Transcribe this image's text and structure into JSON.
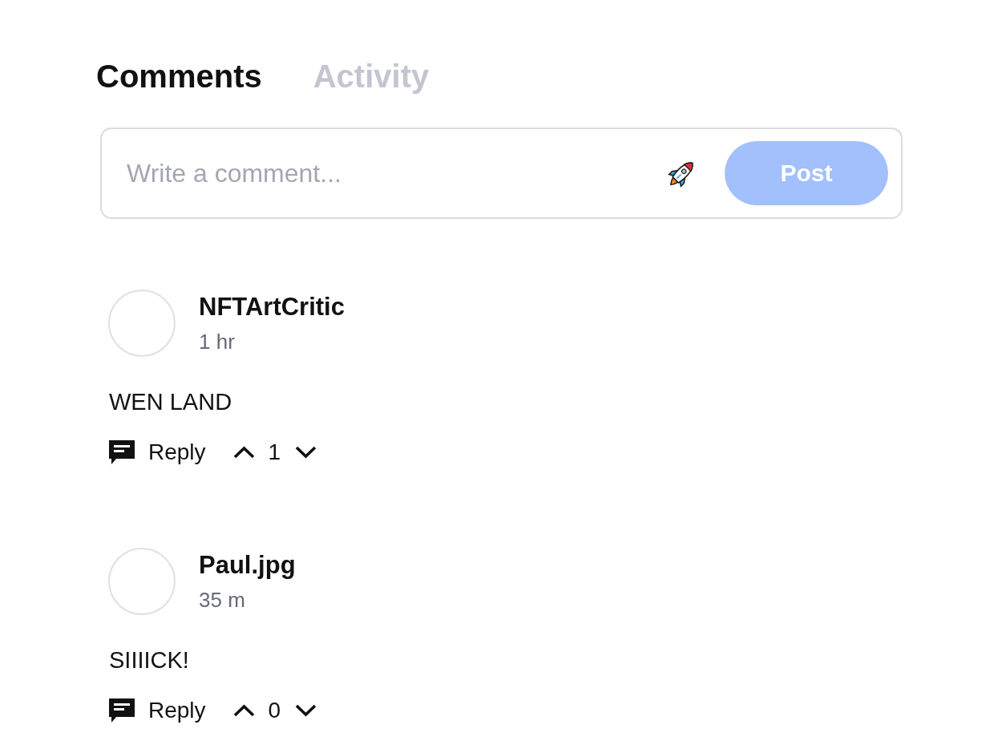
{
  "tabs": [
    {
      "label": "Comments",
      "selected": true
    },
    {
      "label": "Activity",
      "selected": false
    }
  ],
  "composer": {
    "placeholder": "Write a comment...",
    "post_button": {
      "label": "Post",
      "disabled": true
    }
  },
  "comments": [
    {
      "author": "NFTArtCritic",
      "time": "1 hr",
      "text": "WEN LAND",
      "reply_label": "Reply",
      "votes": "1"
    },
    {
      "author": "Paul.jpg",
      "time": "35 m",
      "text": "SIIIICK!",
      "reply_label": "Reply",
      "votes": "0"
    }
  ]
}
